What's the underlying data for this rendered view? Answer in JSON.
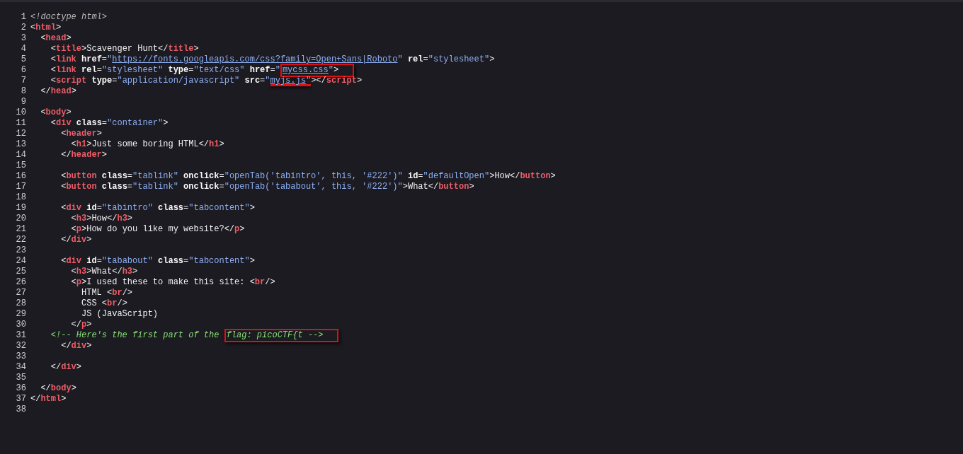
{
  "source_lines": [
    {
      "number": "1",
      "tokens": [
        {
          "kind": "doctype",
          "text": "<!doctype html>"
        }
      ]
    },
    {
      "number": "2",
      "tokens": [
        {
          "kind": "punct",
          "text": "<"
        },
        {
          "kind": "tag",
          "text": "html"
        },
        {
          "kind": "punct",
          "text": ">"
        }
      ]
    },
    {
      "number": "3",
      "tokens": [
        {
          "kind": "punct",
          "text": "  <"
        },
        {
          "kind": "tag",
          "text": "head"
        },
        {
          "kind": "punct",
          "text": ">"
        }
      ]
    },
    {
      "number": "4",
      "tokens": [
        {
          "kind": "punct",
          "text": "    <"
        },
        {
          "kind": "tag",
          "text": "title"
        },
        {
          "kind": "punct",
          "text": ">"
        },
        {
          "kind": "text",
          "text": "Scavenger Hunt"
        },
        {
          "kind": "punct",
          "text": "</"
        },
        {
          "kind": "tag",
          "text": "title"
        },
        {
          "kind": "punct",
          "text": ">"
        }
      ]
    },
    {
      "number": "5",
      "tokens": [
        {
          "kind": "punct",
          "text": "    <"
        },
        {
          "kind": "tag",
          "text": "link"
        },
        {
          "kind": "attr",
          "text": " href"
        },
        {
          "kind": "punct",
          "text": "="
        },
        {
          "kind": "value",
          "text": "\""
        },
        {
          "kind": "link",
          "text": "https://fonts.googleapis.com/css?family=Open+Sans|Roboto"
        },
        {
          "kind": "value",
          "text": "\""
        },
        {
          "kind": "attr",
          "text": " rel"
        },
        {
          "kind": "punct",
          "text": "="
        },
        {
          "kind": "value",
          "text": "\"stylesheet\""
        },
        {
          "kind": "punct",
          "text": ">"
        }
      ]
    },
    {
      "number": "6",
      "tokens": [
        {
          "kind": "punct",
          "text": "    <"
        },
        {
          "kind": "tag",
          "text": "link"
        },
        {
          "kind": "attr",
          "text": " rel"
        },
        {
          "kind": "punct",
          "text": "="
        },
        {
          "kind": "value",
          "text": "\"stylesheet\""
        },
        {
          "kind": "attr",
          "text": " type"
        },
        {
          "kind": "punct",
          "text": "="
        },
        {
          "kind": "value",
          "text": "\"text/css\""
        },
        {
          "kind": "attr",
          "text": " href"
        },
        {
          "kind": "punct",
          "text": "="
        },
        {
          "kind": "value",
          "text": "\""
        },
        {
          "kind": "link",
          "text": "mycss.css",
          "boxed": true
        },
        {
          "kind": "value",
          "text": "\"",
          "boxed": true
        },
        {
          "kind": "punct",
          "text": ">",
          "boxed": true
        }
      ]
    },
    {
      "number": "7",
      "tokens": [
        {
          "kind": "punct",
          "text": "    <"
        },
        {
          "kind": "tag",
          "text": "script"
        },
        {
          "kind": "attr",
          "text": " type"
        },
        {
          "kind": "punct",
          "text": "="
        },
        {
          "kind": "value",
          "text": "\"application/javascript\""
        },
        {
          "kind": "attr",
          "text": " src"
        },
        {
          "kind": "punct",
          "text": "="
        },
        {
          "kind": "value",
          "text": "\""
        },
        {
          "kind": "link",
          "text": "myjs.js",
          "underlined": true
        },
        {
          "kind": "value",
          "text": "\"",
          "underlined": true
        },
        {
          "kind": "punct",
          "text": "></"
        },
        {
          "kind": "tag",
          "text": "script"
        },
        {
          "kind": "punct",
          "text": ">"
        }
      ]
    },
    {
      "number": "8",
      "tokens": [
        {
          "kind": "punct",
          "text": "  </"
        },
        {
          "kind": "tag",
          "text": "head"
        },
        {
          "kind": "punct",
          "text": ">"
        }
      ]
    },
    {
      "number": "9"
    },
    {
      "number": "10",
      "tokens": [
        {
          "kind": "punct",
          "text": "  <"
        },
        {
          "kind": "tag",
          "text": "body"
        },
        {
          "kind": "punct",
          "text": ">"
        }
      ]
    },
    {
      "number": "11",
      "tokens": [
        {
          "kind": "punct",
          "text": "    <"
        },
        {
          "kind": "tag",
          "text": "div"
        },
        {
          "kind": "attr",
          "text": " class"
        },
        {
          "kind": "punct",
          "text": "="
        },
        {
          "kind": "value",
          "text": "\"container\""
        },
        {
          "kind": "punct",
          "text": ">"
        }
      ]
    },
    {
      "number": "12",
      "tokens": [
        {
          "kind": "punct",
          "text": "      <"
        },
        {
          "kind": "tag",
          "text": "header"
        },
        {
          "kind": "punct",
          "text": ">"
        }
      ]
    },
    {
      "number": "13",
      "tokens": [
        {
          "kind": "punct",
          "text": "        <"
        },
        {
          "kind": "tag",
          "text": "h1"
        },
        {
          "kind": "punct",
          "text": ">"
        },
        {
          "kind": "text",
          "text": "Just some boring HTML"
        },
        {
          "kind": "punct",
          "text": "</"
        },
        {
          "kind": "tag",
          "text": "h1"
        },
        {
          "kind": "punct",
          "text": ">"
        }
      ]
    },
    {
      "number": "14",
      "tokens": [
        {
          "kind": "punct",
          "text": "      </"
        },
        {
          "kind": "tag",
          "text": "header"
        },
        {
          "kind": "punct",
          "text": ">"
        }
      ]
    },
    {
      "number": "15"
    },
    {
      "number": "16",
      "tokens": [
        {
          "kind": "punct",
          "text": "      <"
        },
        {
          "kind": "tag",
          "text": "button"
        },
        {
          "kind": "attr",
          "text": " class"
        },
        {
          "kind": "punct",
          "text": "="
        },
        {
          "kind": "value",
          "text": "\"tablink\""
        },
        {
          "kind": "attr",
          "text": " onclick"
        },
        {
          "kind": "punct",
          "text": "="
        },
        {
          "kind": "value",
          "text": "\"openTab('tabintro', this, '#222')\""
        },
        {
          "kind": "attr",
          "text": " id"
        },
        {
          "kind": "punct",
          "text": "="
        },
        {
          "kind": "value",
          "text": "\"defaultOpen\""
        },
        {
          "kind": "punct",
          "text": ">"
        },
        {
          "kind": "text",
          "text": "How"
        },
        {
          "kind": "punct",
          "text": "</"
        },
        {
          "kind": "tag",
          "text": "button"
        },
        {
          "kind": "punct",
          "text": ">"
        }
      ]
    },
    {
      "number": "17",
      "tokens": [
        {
          "kind": "punct",
          "text": "      <"
        },
        {
          "kind": "tag",
          "text": "button"
        },
        {
          "kind": "attr",
          "text": " class"
        },
        {
          "kind": "punct",
          "text": "="
        },
        {
          "kind": "value",
          "text": "\"tablink\""
        },
        {
          "kind": "attr",
          "text": " onclick"
        },
        {
          "kind": "punct",
          "text": "="
        },
        {
          "kind": "value",
          "text": "\"openTab('tababout', this, '#222')\""
        },
        {
          "kind": "punct",
          "text": ">"
        },
        {
          "kind": "text",
          "text": "What"
        },
        {
          "kind": "punct",
          "text": "</"
        },
        {
          "kind": "tag",
          "text": "button"
        },
        {
          "kind": "punct",
          "text": ">"
        }
      ]
    },
    {
      "number": "18"
    },
    {
      "number": "19",
      "tokens": [
        {
          "kind": "punct",
          "text": "      <"
        },
        {
          "kind": "tag",
          "text": "div"
        },
        {
          "kind": "attr",
          "text": " id"
        },
        {
          "kind": "punct",
          "text": "="
        },
        {
          "kind": "value",
          "text": "\"tabintro\""
        },
        {
          "kind": "attr",
          "text": " class"
        },
        {
          "kind": "punct",
          "text": "="
        },
        {
          "kind": "value",
          "text": "\"tabcontent\""
        },
        {
          "kind": "punct",
          "text": ">"
        }
      ]
    },
    {
      "number": "20",
      "tokens": [
        {
          "kind": "punct",
          "text": "        <"
        },
        {
          "kind": "tag",
          "text": "h3"
        },
        {
          "kind": "punct",
          "text": ">"
        },
        {
          "kind": "text",
          "text": "How"
        },
        {
          "kind": "punct",
          "text": "</"
        },
        {
          "kind": "tag",
          "text": "h3"
        },
        {
          "kind": "punct",
          "text": ">"
        }
      ]
    },
    {
      "number": "21",
      "tokens": [
        {
          "kind": "punct",
          "text": "        <"
        },
        {
          "kind": "tag",
          "text": "p"
        },
        {
          "kind": "punct",
          "text": ">"
        },
        {
          "kind": "text",
          "text": "How do you like my website?"
        },
        {
          "kind": "punct",
          "text": "</"
        },
        {
          "kind": "tag",
          "text": "p"
        },
        {
          "kind": "punct",
          "text": ">"
        }
      ]
    },
    {
      "number": "22",
      "tokens": [
        {
          "kind": "punct",
          "text": "      </"
        },
        {
          "kind": "tag",
          "text": "div"
        },
        {
          "kind": "punct",
          "text": ">"
        }
      ]
    },
    {
      "number": "23"
    },
    {
      "number": "24",
      "tokens": [
        {
          "kind": "punct",
          "text": "      <"
        },
        {
          "kind": "tag",
          "text": "div"
        },
        {
          "kind": "attr",
          "text": " id"
        },
        {
          "kind": "punct",
          "text": "="
        },
        {
          "kind": "value",
          "text": "\"tababout\""
        },
        {
          "kind": "attr",
          "text": " class"
        },
        {
          "kind": "punct",
          "text": "="
        },
        {
          "kind": "value",
          "text": "\"tabcontent\""
        },
        {
          "kind": "punct",
          "text": ">"
        }
      ]
    },
    {
      "number": "25",
      "tokens": [
        {
          "kind": "punct",
          "text": "        <"
        },
        {
          "kind": "tag",
          "text": "h3"
        },
        {
          "kind": "punct",
          "text": ">"
        },
        {
          "kind": "text",
          "text": "What"
        },
        {
          "kind": "punct",
          "text": "</"
        },
        {
          "kind": "tag",
          "text": "h3"
        },
        {
          "kind": "punct",
          "text": ">"
        }
      ]
    },
    {
      "number": "26",
      "tokens": [
        {
          "kind": "punct",
          "text": "        <"
        },
        {
          "kind": "tag",
          "text": "p"
        },
        {
          "kind": "punct",
          "text": ">"
        },
        {
          "kind": "text",
          "text": "I used these to make this site: "
        },
        {
          "kind": "punct",
          "text": "<"
        },
        {
          "kind": "tag",
          "text": "br"
        },
        {
          "kind": "punct",
          "text": "/>"
        }
      ]
    },
    {
      "number": "27",
      "tokens": [
        {
          "kind": "text",
          "text": "          HTML "
        },
        {
          "kind": "punct",
          "text": "<"
        },
        {
          "kind": "tag",
          "text": "br"
        },
        {
          "kind": "punct",
          "text": "/>"
        }
      ]
    },
    {
      "number": "28",
      "tokens": [
        {
          "kind": "text",
          "text": "          CSS "
        },
        {
          "kind": "punct",
          "text": "<"
        },
        {
          "kind": "tag",
          "text": "br"
        },
        {
          "kind": "punct",
          "text": "/>"
        }
      ]
    },
    {
      "number": "29",
      "tokens": [
        {
          "kind": "text",
          "text": "          JS (JavaScript)"
        }
      ]
    },
    {
      "number": "30",
      "tokens": [
        {
          "kind": "punct",
          "text": "        </"
        },
        {
          "kind": "tag",
          "text": "p"
        },
        {
          "kind": "punct",
          "text": ">"
        }
      ]
    },
    {
      "number": "31",
      "tokens": [
        {
          "kind": "comment",
          "text": "    <!-- Here's the first part of the "
        },
        {
          "kind": "comment",
          "text": "flag: picoCTF{t -->",
          "boxed": true
        }
      ]
    },
    {
      "number": "32",
      "tokens": [
        {
          "kind": "punct",
          "text": "      </"
        },
        {
          "kind": "tag",
          "text": "div"
        },
        {
          "kind": "punct",
          "text": ">"
        }
      ]
    },
    {
      "number": "33"
    },
    {
      "number": "34",
      "tokens": [
        {
          "kind": "punct",
          "text": "    </"
        },
        {
          "kind": "tag",
          "text": "div"
        },
        {
          "kind": "punct",
          "text": ">"
        }
      ]
    },
    {
      "number": "35"
    },
    {
      "number": "36",
      "tokens": [
        {
          "kind": "punct",
          "text": "  </"
        },
        {
          "kind": "tag",
          "text": "body"
        },
        {
          "kind": "punct",
          "text": ">"
        }
      ]
    },
    {
      "number": "37",
      "tokens": [
        {
          "kind": "punct",
          "text": "</"
        },
        {
          "kind": "tag",
          "text": "html"
        },
        {
          "kind": "punct",
          "text": ">"
        }
      ]
    },
    {
      "number": "38"
    }
  ]
}
